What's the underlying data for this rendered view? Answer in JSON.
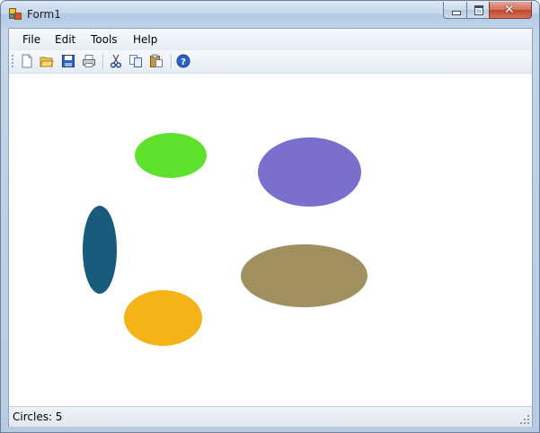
{
  "window": {
    "title": "Form1",
    "app_icon": "windows-forms-app-icon"
  },
  "title_controls": {
    "minimize_icon": "minimize-icon",
    "maximize_icon": "maximize-icon",
    "close_icon": "close-icon",
    "close_glyph": "✕"
  },
  "menu": {
    "items": [
      {
        "label": "File"
      },
      {
        "label": "Edit"
      },
      {
        "label": "Tools"
      },
      {
        "label": "Help"
      }
    ]
  },
  "toolbar": {
    "buttons": [
      {
        "icon": "new-file-icon"
      },
      {
        "icon": "open-folder-icon"
      },
      {
        "icon": "save-icon"
      },
      {
        "icon": "print-icon"
      },
      {
        "icon": "cut-icon"
      },
      {
        "icon": "copy-icon"
      },
      {
        "icon": "paste-icon"
      },
      {
        "icon": "help-icon"
      }
    ]
  },
  "canvas": {
    "shapes": [
      {
        "name": "green-ellipse",
        "color": "#5fe02d"
      },
      {
        "name": "purple-ellipse",
        "color": "#7870cc"
      },
      {
        "name": "teal-ellipse",
        "color": "#195b7a"
      },
      {
        "name": "olive-ellipse",
        "color": "#a09060"
      },
      {
        "name": "orange-ellipse",
        "color": "#f4b316"
      }
    ]
  },
  "status": {
    "text": "Circles: 5"
  },
  "colors": {
    "accent": "#1e5bb8",
    "window_frame": "#b7cbe3"
  }
}
